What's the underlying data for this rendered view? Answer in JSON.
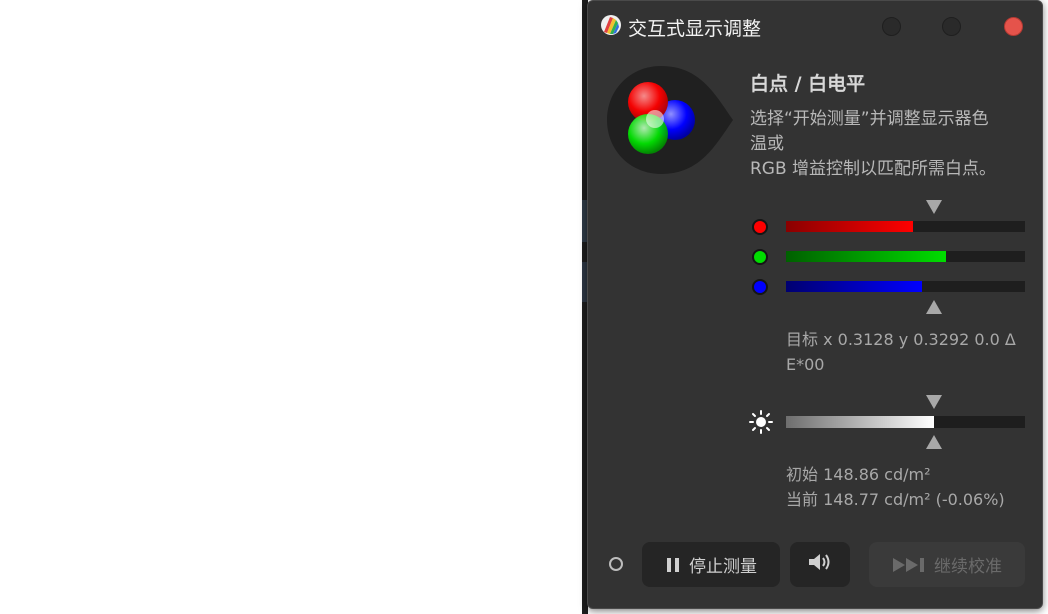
{
  "window": {
    "title": "交互式显示调整"
  },
  "section": {
    "heading": "白点 / 白电平",
    "description": [
      "选择“开始测量”并调整显示器色",
      "温或",
      "RGB 增益控制以匹配所需白点。"
    ]
  },
  "rgb": {
    "red": 0.53,
    "green": 0.67,
    "blue": 0.57,
    "target_marker": 0.62
  },
  "target": {
    "text_line1": "目标 x 0.3128 y 0.3292 0.0 Δ",
    "text_line2": "E*00"
  },
  "luminance": {
    "level": 0.62,
    "initial": "初始 148.86 cd/m²",
    "current": "当前 148.77 cd/m² (-0.06%)"
  },
  "buttons": {
    "stop_label": "停止测量",
    "continue_label": "继续校准"
  },
  "colors": {
    "window_bg": "#333333",
    "red": "#ff0000",
    "green": "#00dd00",
    "blue": "#0000ff",
    "close": "#e5534b"
  }
}
